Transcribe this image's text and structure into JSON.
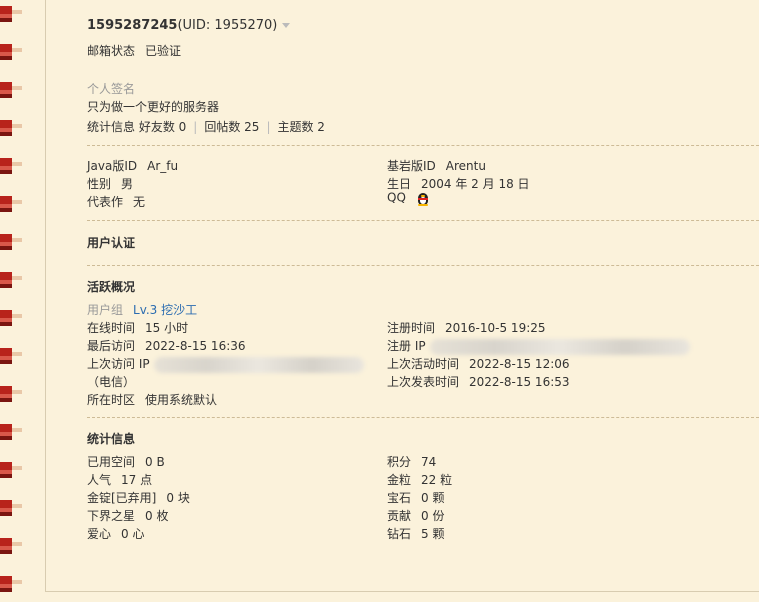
{
  "profile": {
    "username": "1595287245",
    "uid_text": "(UID: 1955270)",
    "email_label": "邮箱状态",
    "email_value": "已验证",
    "signature_label": "个人签名",
    "signature_value": "只为做一个更好的服务器",
    "stats_label": "统计信息",
    "friends": "好友数 0",
    "replies": "回帖数 25",
    "topics": "主题数 2"
  },
  "info": {
    "java_label": "Java版ID",
    "java_value": "Ar_fu",
    "bedrock_label": "基岩版ID",
    "bedrock_value": "Arentu",
    "gender_label": "性别",
    "gender_value": "男",
    "birthday_label": "生日",
    "birthday_value": "2004 年 2 月 18 日",
    "work_label": "代表作",
    "work_value": "无",
    "qq_label": "QQ"
  },
  "auth": {
    "title": "用户认证"
  },
  "activity": {
    "title": "活跃概况",
    "group_label": "用户组",
    "group_value": "Lv.3 挖沙工",
    "online_label": "在线时间",
    "online_value": "15 小时",
    "reg_time_label": "注册时间",
    "reg_time_value": "2016-10-5 19:25",
    "last_visit_label": "最后访问",
    "last_visit_value": "2022-8-15 16:36",
    "reg_ip_label": "注册 IP",
    "last_ip_label": "上次访问 IP",
    "last_active_label": "上次活动时间",
    "last_active_value": "2022-8-15 12:06",
    "isp": "（电信）",
    "last_post_label": "上次发表时间",
    "last_post_value": "2022-8-15 16:53",
    "timezone_label": "所在时区",
    "timezone_value": "使用系统默认"
  },
  "stats": {
    "title": "统计信息",
    "space_label": "已用空间",
    "space_value": "0 B",
    "points_label": "积分",
    "points_value": "74",
    "popularity_label": "人气",
    "popularity_value": "17 点",
    "gold_label": "金粒",
    "gold_value": "22 粒",
    "ingot_label": "金锭[已弃用]",
    "ingot_value": "0 块",
    "gem_label": "宝石",
    "gem_value": "0 颗",
    "nether_label": "下界之星",
    "nether_value": "0 枚",
    "contrib_label": "贡献",
    "contrib_value": "0 份",
    "love_label": "爱心",
    "love_value": "0 心",
    "diamond_label": "钻石",
    "diamond_value": "5 颗"
  }
}
